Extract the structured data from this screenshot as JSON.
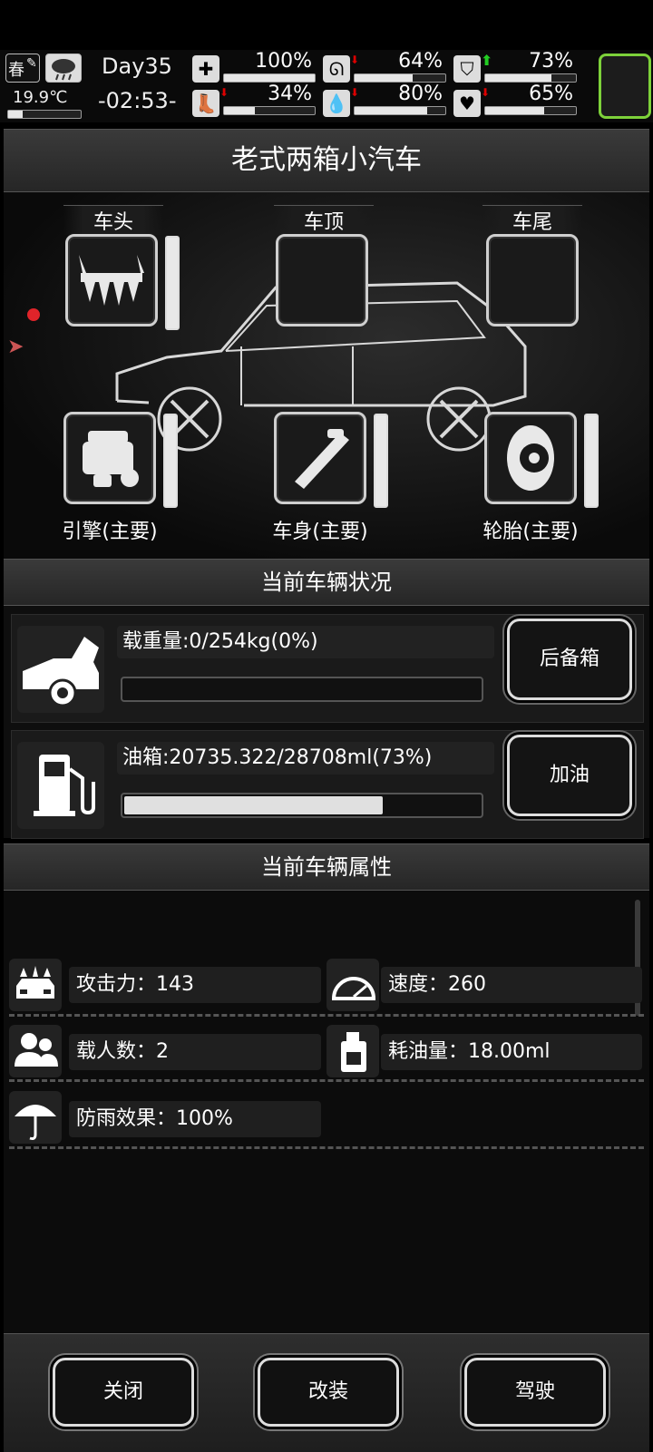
{
  "status_bar": {
    "season": "春",
    "temperature": "19.9℃",
    "day": "Day35",
    "time": "-02:53-",
    "stats": [
      {
        "name": "health",
        "icon": "medkit-icon",
        "percent": "100%",
        "value": 1.0
      },
      {
        "name": "hunger",
        "icon": "stomach-icon",
        "percent": "64%",
        "value": 0.64,
        "trend": "down"
      },
      {
        "name": "mood",
        "icon": "mask-icon",
        "percent": "73%",
        "value": 0.73,
        "trend": "up"
      },
      {
        "name": "stamina",
        "icon": "boot-icon",
        "percent": "34%",
        "value": 0.34,
        "trend": "down"
      },
      {
        "name": "thirst",
        "icon": "water-drop-icon",
        "percent": "80%",
        "value": 0.8,
        "trend": "down"
      },
      {
        "name": "heart",
        "icon": "heart-icon",
        "percent": "65%",
        "value": 0.65,
        "trend": "down"
      }
    ],
    "temperature_level": 0.2
  },
  "vehicle": {
    "name": "老式两箱小汽车",
    "slots": {
      "front": {
        "label": "车头",
        "fill": 1.0,
        "equipped": true
      },
      "roof": {
        "label": "车顶",
        "equipped": false
      },
      "rear": {
        "label": "车尾",
        "equipped": false
      },
      "engine": {
        "label": "引擎(主要)",
        "fill": 1.0,
        "equipped": true
      },
      "body": {
        "label": "车身(主要)",
        "fill": 1.0,
        "equipped": true
      },
      "tire": {
        "label": "轮胎(主要)",
        "fill": 1.0,
        "equipped": true
      }
    }
  },
  "condition": {
    "title": "当前车辆状况",
    "cargo_text": "载重量:0/254kg(0%)",
    "cargo_fill": 0.0,
    "trunk_button": "后备箱",
    "fuel_text": "油箱:20735.322/28708ml(73%)",
    "fuel_fill": 0.73,
    "refuel_button": "加油"
  },
  "attributes": {
    "title": "当前车辆属性",
    "items": [
      {
        "label": "攻击力：143",
        "icon": "spiked-car-icon"
      },
      {
        "label": "速度：260",
        "icon": "speedometer-icon"
      },
      {
        "label": "载人数：2",
        "icon": "people-icon"
      },
      {
        "label": "耗油量：18.00ml",
        "icon": "fuel-can-icon"
      },
      {
        "label": "防雨效果：100%",
        "icon": "umbrella-icon"
      }
    ]
  },
  "footer": {
    "close": "关闭",
    "modify": "改装",
    "drive": "驾驶"
  }
}
